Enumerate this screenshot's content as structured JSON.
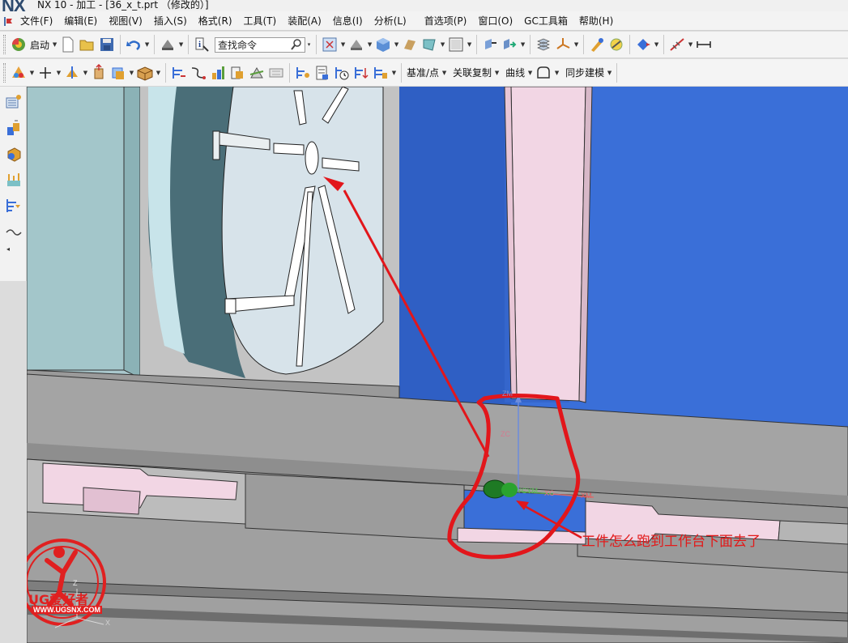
{
  "window": {
    "logo": "NX",
    "title": "NX 10 - 加工 - [36_x_t.prt （修改的）]"
  },
  "menu": {
    "items": [
      "文件(F)",
      "编辑(E)",
      "视图(V)",
      "插入(S)",
      "格式(R)",
      "工具(T)",
      "装配(A)",
      "信息(I)",
      "分析(L)",
      "首选项(P)",
      "窗口(O)",
      "GC工具箱",
      "帮助(H)"
    ]
  },
  "toolbar1": {
    "start_label": "启动",
    "search_placeholder": "查找命令"
  },
  "toolbar2": {
    "datum_label": "基准/点",
    "assoc_copy_label": "关联复制",
    "curve_label": "曲线",
    "sync_label": "同步建模"
  },
  "viewport": {
    "axis_labels": {
      "zm": "ZM",
      "zc": "ZC",
      "ycym": "YCYM",
      "xc": "XC",
      "xm": "XM",
      "triad_z": "Z",
      "triad_x": "X"
    },
    "annotation": "工件怎么跑到工作台下面去了",
    "colors": {
      "annotation": "#e21a1a",
      "background_blue": "#3a6fd8",
      "machine_gray": "#a9a9a9",
      "pink_rail": "#f2d6e4"
    }
  },
  "watermark": {
    "brand": "UG爱好者",
    "url": "WWW.UGSNX.COM"
  }
}
